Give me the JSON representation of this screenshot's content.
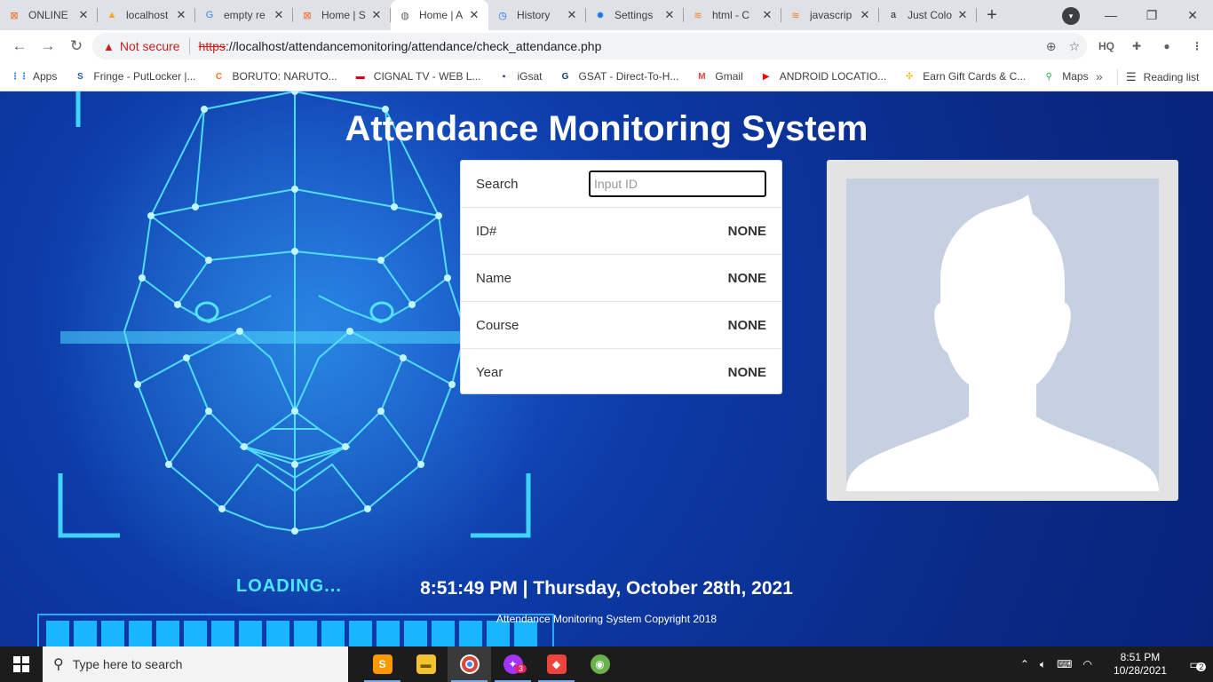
{
  "browser": {
    "tabs": [
      {
        "title": "ONLINE",
        "favicon": "xampp-icon",
        "color": "#f26522",
        "glyph": "⊠"
      },
      {
        "title": "localhost",
        "favicon": "phpmyadmin-icon",
        "color": "#f5a623",
        "glyph": "▲"
      },
      {
        "title": "empty re",
        "favicon": "google-icon",
        "color": "#4285f4",
        "glyph": "G"
      },
      {
        "title": "Home | S",
        "favicon": "xampp-icon",
        "color": "#f26522",
        "glyph": "⊠"
      },
      {
        "title": "Home | A",
        "favicon": "globe-icon",
        "color": "#5f6368",
        "glyph": "◍",
        "active": true
      },
      {
        "title": "History",
        "favicon": "history-icon",
        "color": "#1a73e8",
        "glyph": "◷"
      },
      {
        "title": "Settings",
        "favicon": "settings-icon",
        "color": "#1a73e8",
        "glyph": "✹"
      },
      {
        "title": "html - C",
        "favicon": "stackoverflow-icon",
        "color": "#f48024",
        "glyph": "≋"
      },
      {
        "title": "javascrip",
        "favicon": "stackoverflow-icon",
        "color": "#f48024",
        "glyph": "≋"
      },
      {
        "title": "Just Colo",
        "favicon": "justcolor-icon",
        "color": "#222",
        "glyph": "a"
      }
    ],
    "security_label": "Not secure",
    "url_scheme": "https",
    "url_rest": "://localhost/attendancemonitoring/attendance/check_attendance.php",
    "bookmarks": [
      {
        "label": "Apps",
        "icon": "apps-grid-icon",
        "color": "#1a73e8",
        "glyph": "⋮⋮"
      },
      {
        "label": "Fringe - PutLocker |...",
        "icon": "putlocker-icon",
        "color": "#2a5db0",
        "glyph": "S"
      },
      {
        "label": "BORUTO: NARUTO...",
        "icon": "crunchyroll-icon",
        "color": "#f47521",
        "glyph": "C"
      },
      {
        "label": "CIGNAL TV - WEB L...",
        "icon": "cignal-icon",
        "color": "#d0021b",
        "glyph": "▬"
      },
      {
        "label": "iGsat",
        "icon": "igsat-icon",
        "color": "#1b3a6b",
        "glyph": "▪"
      },
      {
        "label": "GSAT - Direct-To-H...",
        "icon": "gsat-icon",
        "color": "#1b3a6b",
        "glyph": "G"
      },
      {
        "label": "Gmail",
        "icon": "gmail-icon",
        "color": "#ea4335",
        "glyph": "M"
      },
      {
        "label": "ANDROID LOCATIO...",
        "icon": "youtube-icon",
        "color": "#ff0000",
        "glyph": "▶"
      },
      {
        "label": "Earn Gift Cards & C...",
        "icon": "giftcard-icon",
        "color": "#f4b400",
        "glyph": "✣"
      },
      {
        "label": "Maps",
        "icon": "maps-pin-icon",
        "color": "#34a853",
        "glyph": "⚲"
      }
    ],
    "reading_list": "Reading list"
  },
  "page": {
    "title": "Attendance Monitoring System",
    "search_label": "Search",
    "search_placeholder": "Input ID",
    "fields": [
      {
        "label": "ID#",
        "value": "NONE"
      },
      {
        "label": "Name",
        "value": "NONE"
      },
      {
        "label": "Course",
        "value": "NONE"
      },
      {
        "label": "Year",
        "value": "NONE"
      }
    ],
    "loading_text": "LOADING...",
    "clock": "8:51:49 PM | Thursday, October 28th, 2021",
    "footer": "Attendance Monitoring System Copyright 2018"
  },
  "taskbar": {
    "search_placeholder": "Type here to search",
    "badge_count": "3",
    "time": "8:51 PM",
    "date": "10/28/2021",
    "notification_count": "2"
  }
}
